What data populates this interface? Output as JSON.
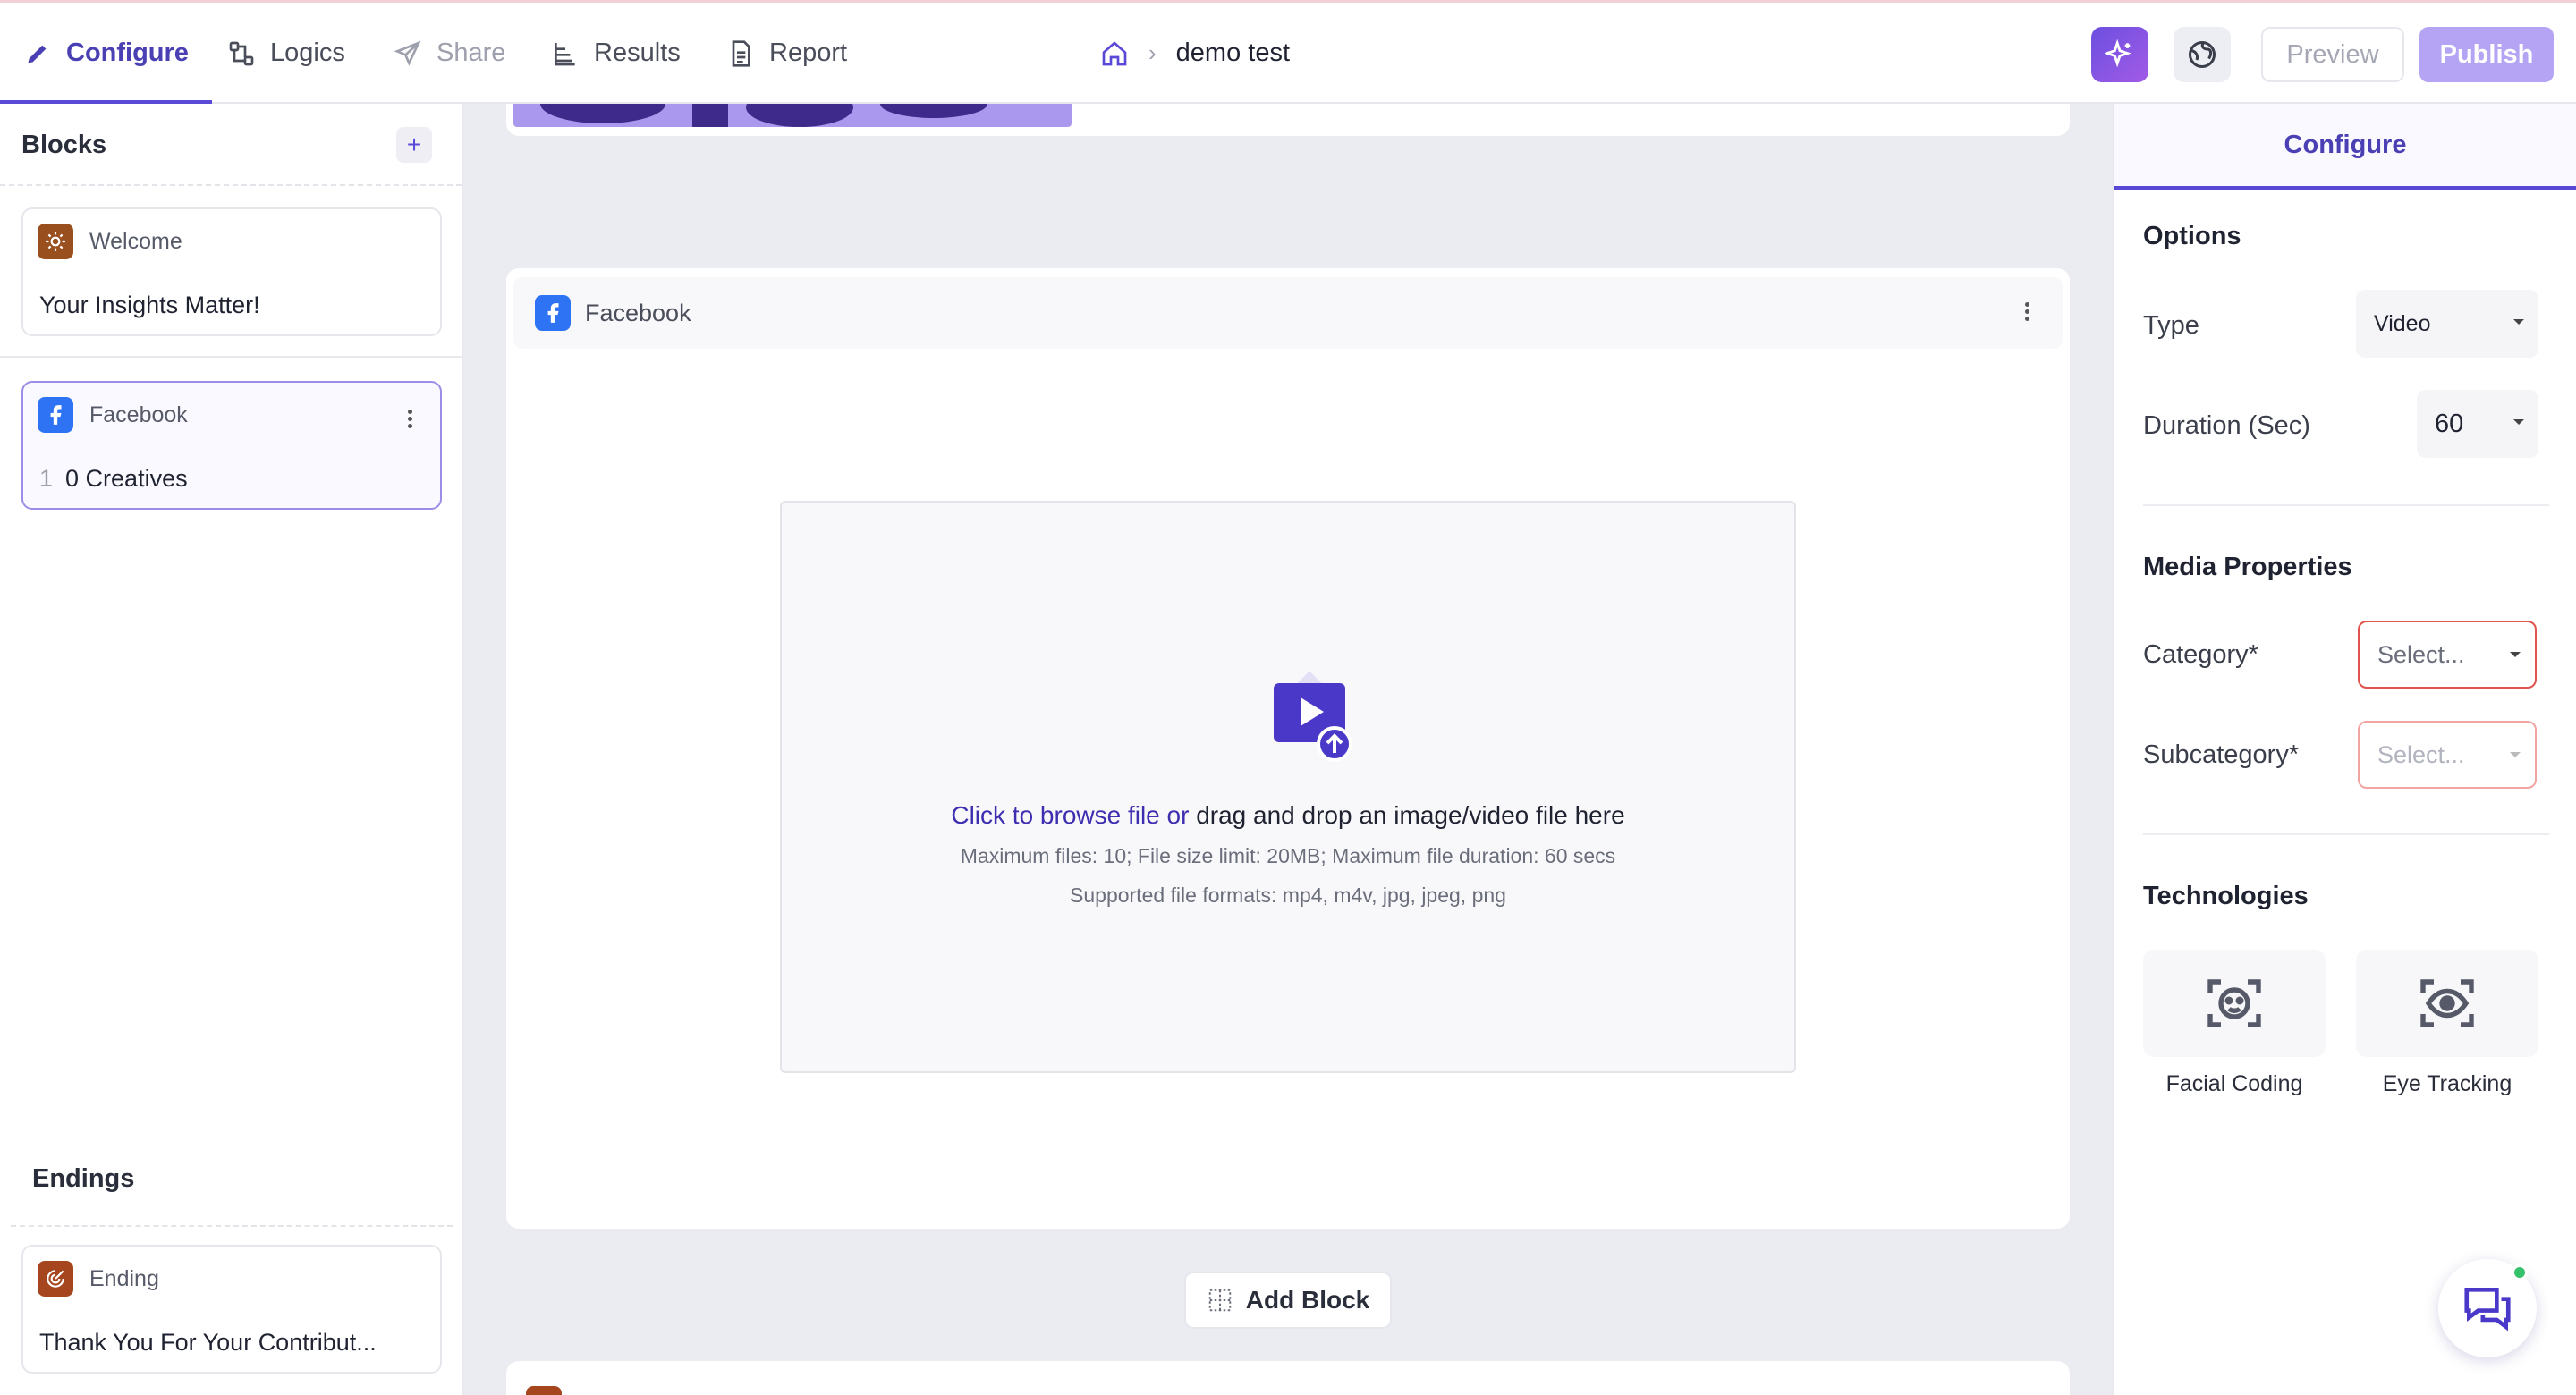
{
  "nav": {
    "tabs": [
      {
        "label": "Configure",
        "icon": "pencil-icon",
        "state": "active"
      },
      {
        "label": "Logics",
        "icon": "nodes-icon",
        "state": "normal"
      },
      {
        "label": "Share",
        "icon": "send-icon",
        "state": "disabled"
      },
      {
        "label": "Results",
        "icon": "results-icon",
        "state": "normal"
      },
      {
        "label": "Report",
        "icon": "document-icon",
        "state": "normal"
      }
    ],
    "breadcrumb": {
      "project": "demo test"
    },
    "preview_label": "Preview",
    "publish_label": "Publish"
  },
  "sidebar": {
    "blocks_title": "Blocks",
    "add_symbol": "+",
    "blocks": [
      {
        "type": "Welcome",
        "icon": "sun-icon",
        "body": "Your Insights Matter!"
      },
      {
        "type": "Facebook",
        "icon": "facebook-icon",
        "index": "1",
        "body": "0 Creatives"
      }
    ],
    "endings_title": "Endings",
    "endings": [
      {
        "type": "Ending",
        "icon": "target-icon",
        "body": "Thank You For Your Contribut..."
      }
    ]
  },
  "canvas": {
    "facebook_block": {
      "label": "Facebook",
      "dropzone": {
        "link_text": "Click to browse file or",
        "rest_text": " drag and drop an image/video file here",
        "limits": "Maximum files: 10; File size limit: 20MB; Maximum file duration: 60 secs",
        "formats": "Supported file formats: mp4, m4v, jpg, jpeg, png"
      }
    },
    "add_block_label": "Add Block"
  },
  "right_panel": {
    "tab_label": "Configure",
    "options_title": "Options",
    "type_label": "Type",
    "type_value": "Video",
    "duration_label": "Duration (Sec)",
    "duration_value": "60",
    "media_title": "Media Properties",
    "category_label": "Category*",
    "category_placeholder": "Select...",
    "subcategory_label": "Subcategory*",
    "subcategory_placeholder": "Select...",
    "tech_title": "Technologies",
    "technologies": [
      {
        "label": "Facial Coding",
        "icon": "face-scan-icon"
      },
      {
        "label": "Eye Tracking",
        "icon": "eye-scan-icon"
      }
    ]
  },
  "colors": {
    "accent": "#5a48d6",
    "publish": "#b4a4f3",
    "error_border": "#e0534f",
    "facebook": "#2f73f5",
    "welcome_badge": "#9a4f1e"
  }
}
